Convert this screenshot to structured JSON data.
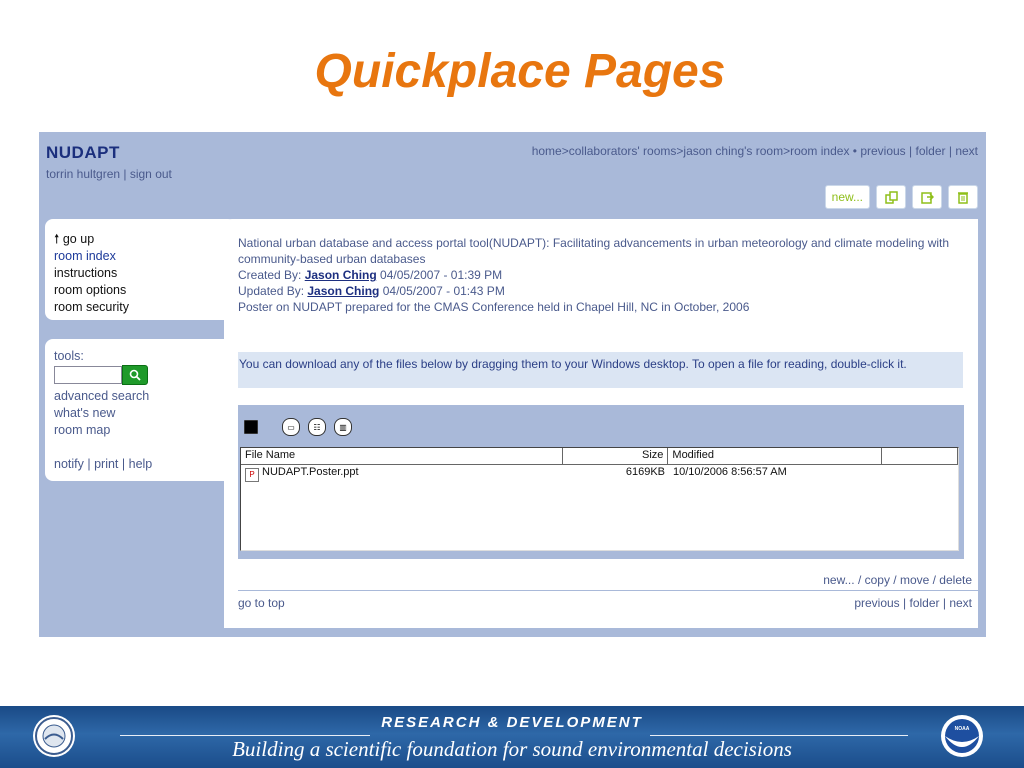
{
  "slide": {
    "title": "Quickplace Pages"
  },
  "header": {
    "room_name": "NUDAPT",
    "user_name": "torrin hultgren",
    "user_sep": " | ",
    "sign_out": "sign out",
    "breadcrumb": "home>collaborators' rooms>jason ching's room>room index",
    "bullet": " • ",
    "nav_previous": "previous",
    "nav_folder": "folder",
    "nav_next": "next",
    "sep": " | "
  },
  "toolbar": {
    "new_label": "new..."
  },
  "nav": {
    "go_up": "go up",
    "room_index": "room index",
    "instructions": "instructions",
    "room_options": "room options",
    "room_security": "room security"
  },
  "tools": {
    "label": "tools:",
    "search_value": "",
    "advanced_search": "advanced search",
    "whats_new": "what's new",
    "room_map": "room map",
    "notify": "notify",
    "print": "print",
    "help": "help",
    "sep": " | "
  },
  "document": {
    "title_line": "National urban database and access portal tool(NUDAPT): Facilitating advancements in urban meteorology and climate modeling with community-based urban databases",
    "created_prefix": "Created By: ",
    "created_by": "Jason Ching",
    "created_date": " 04/05/2007 - 01:39 PM",
    "updated_prefix": "Updated By: ",
    "updated_by": "Jason Ching",
    "updated_date": " 04/05/2007 - 01:43 PM",
    "note": "Poster on NUDAPT prepared for the CMAS Conference held in Chapel Hill, NC in October, 2006"
  },
  "notice": "You can download any of the files below by dragging them to your Windows desktop. To open a file for reading, double-click it.",
  "files": {
    "columns": [
      "File Name",
      "Size",
      "Modified",
      ""
    ],
    "rows": [
      {
        "name": "NUDAPT.Poster.ppt",
        "size": "6169KB",
        "modified": "10/10/2006 8:56:57 AM"
      }
    ]
  },
  "actions": "new... / copy / move / delete",
  "footer_nav": {
    "go_to_top": "go to top",
    "previous": "previous",
    "folder": "folder",
    "next": "next",
    "sep": " | "
  },
  "banner": {
    "line1": "RESEARCH & DEVELOPMENT",
    "line2": "Building a scientific foundation for sound environmental decisions",
    "left_seal_text": "EPA",
    "right_seal_text": "NOAA"
  },
  "colors": {
    "title": "#e8760f",
    "app_bg": "#a9b9d9",
    "link": "#4a5a8c",
    "banner": "#1f5696"
  }
}
